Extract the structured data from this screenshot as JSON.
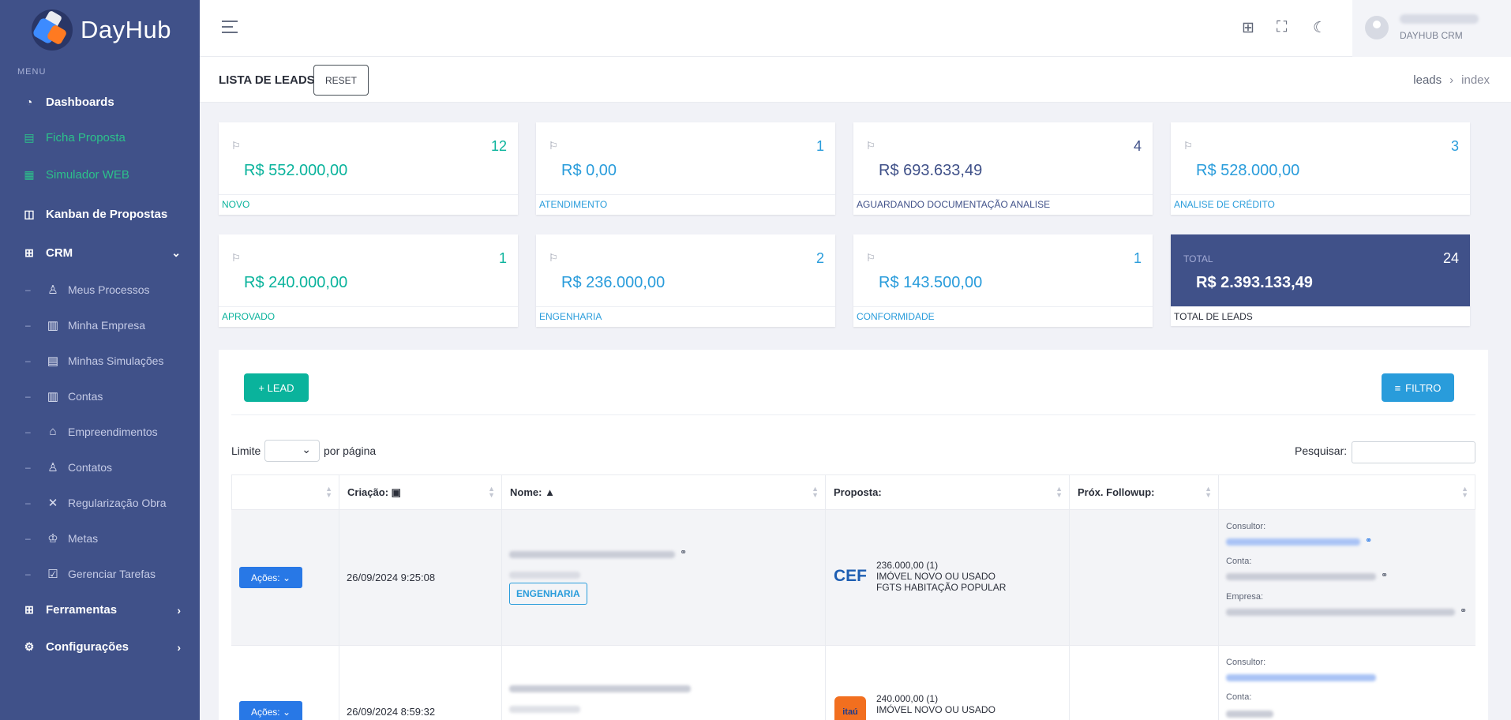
{
  "app": {
    "name": "DayHub"
  },
  "sidebar": {
    "menu_title": "MENU",
    "items": [
      {
        "label": "Dashboards",
        "icon": "dashboard-icon"
      },
      {
        "label": "Ficha Proposta",
        "icon": "form-icon"
      },
      {
        "label": "Simulador WEB",
        "icon": "calculator-icon"
      },
      {
        "label": "Kanban de Propostas",
        "icon": "kanban-icon"
      },
      {
        "label": "CRM",
        "icon": "apps-icon"
      }
    ],
    "crm_sub": [
      {
        "label": "Meus Processos",
        "icon": "user-icon"
      },
      {
        "label": "Minha Empresa",
        "icon": "building-icon"
      },
      {
        "label": "Minhas Simulações",
        "icon": "calculator-icon"
      },
      {
        "label": "Contas",
        "icon": "building-icon"
      },
      {
        "label": "Empreendimentos",
        "icon": "building-icon"
      },
      {
        "label": "Contatos",
        "icon": "contacts-icon"
      },
      {
        "label": "Regularização Obra",
        "icon": "tools-icon"
      },
      {
        "label": "Metas",
        "icon": "trophy-icon"
      },
      {
        "label": "Gerenciar Tarefas",
        "icon": "task-icon"
      }
    ],
    "bottom": [
      {
        "label": "Ferramentas",
        "icon": "tools-grid-icon"
      },
      {
        "label": "Configurações",
        "icon": "gear-icon"
      }
    ]
  },
  "header": {
    "user_role": "DAYHUB CRM"
  },
  "page": {
    "title": "LISTA DE LEADS:",
    "reset": "RESET",
    "breadcrumb": [
      "leads",
      "index"
    ]
  },
  "cards": [
    {
      "count": "12",
      "amount": "R$  552.000,00",
      "label": "NOVO"
    },
    {
      "count": "1",
      "amount": "R$  0,00",
      "label": "ATENDIMENTO"
    },
    {
      "count": "4",
      "amount": "R$  693.633,49",
      "label": "AGUARDANDO DOCUMENTAÇÃO ANALISE"
    },
    {
      "count": "3",
      "amount": "R$  528.000,00",
      "label": "ANALISE DE CRÉDITO"
    },
    {
      "count": "1",
      "amount": "R$  240.000,00",
      "label": "APROVADO"
    },
    {
      "count": "2",
      "amount": "R$  236.000,00",
      "label": "ENGENHARIA"
    },
    {
      "count": "1",
      "amount": "R$  143.500,00",
      "label": "CONFORMIDADE"
    },
    {
      "count": "24",
      "amount": "R$  2.393.133,49",
      "label": "TOTAL DE LEADS",
      "top_label": "TOTAL"
    }
  ],
  "toolbar": {
    "lead": "+  LEAD",
    "filter": "FILTRO"
  },
  "table_controls": {
    "limit": "Limite",
    "per_page": "por página",
    "search": "Pesquisar:"
  },
  "columns": [
    "",
    "Criação:",
    "Nome:",
    "Proposta:",
    "Próx. Followup:",
    ""
  ],
  "rows": [
    {
      "acoes": "Ações:",
      "date": "26/09/2024 9:25:08",
      "tag": "ENGENHARIA",
      "bank": "CEF",
      "proposal": [
        "236.000,00 (1)",
        "IMÓVEL NOVO OU USADO",
        "FGTS HABITAÇÃO POPULAR"
      ],
      "labels": [
        "Consultor:",
        "Conta:",
        "Empresa:"
      ]
    },
    {
      "acoes": "Ações:",
      "date": "26/09/2024 8:59:32",
      "bank": "itaú",
      "proposal": [
        "240.000,00 (1)",
        "IMÓVEL NOVO OU USADO"
      ],
      "labels": [
        "Consultor:",
        "Conta:"
      ]
    }
  ]
}
